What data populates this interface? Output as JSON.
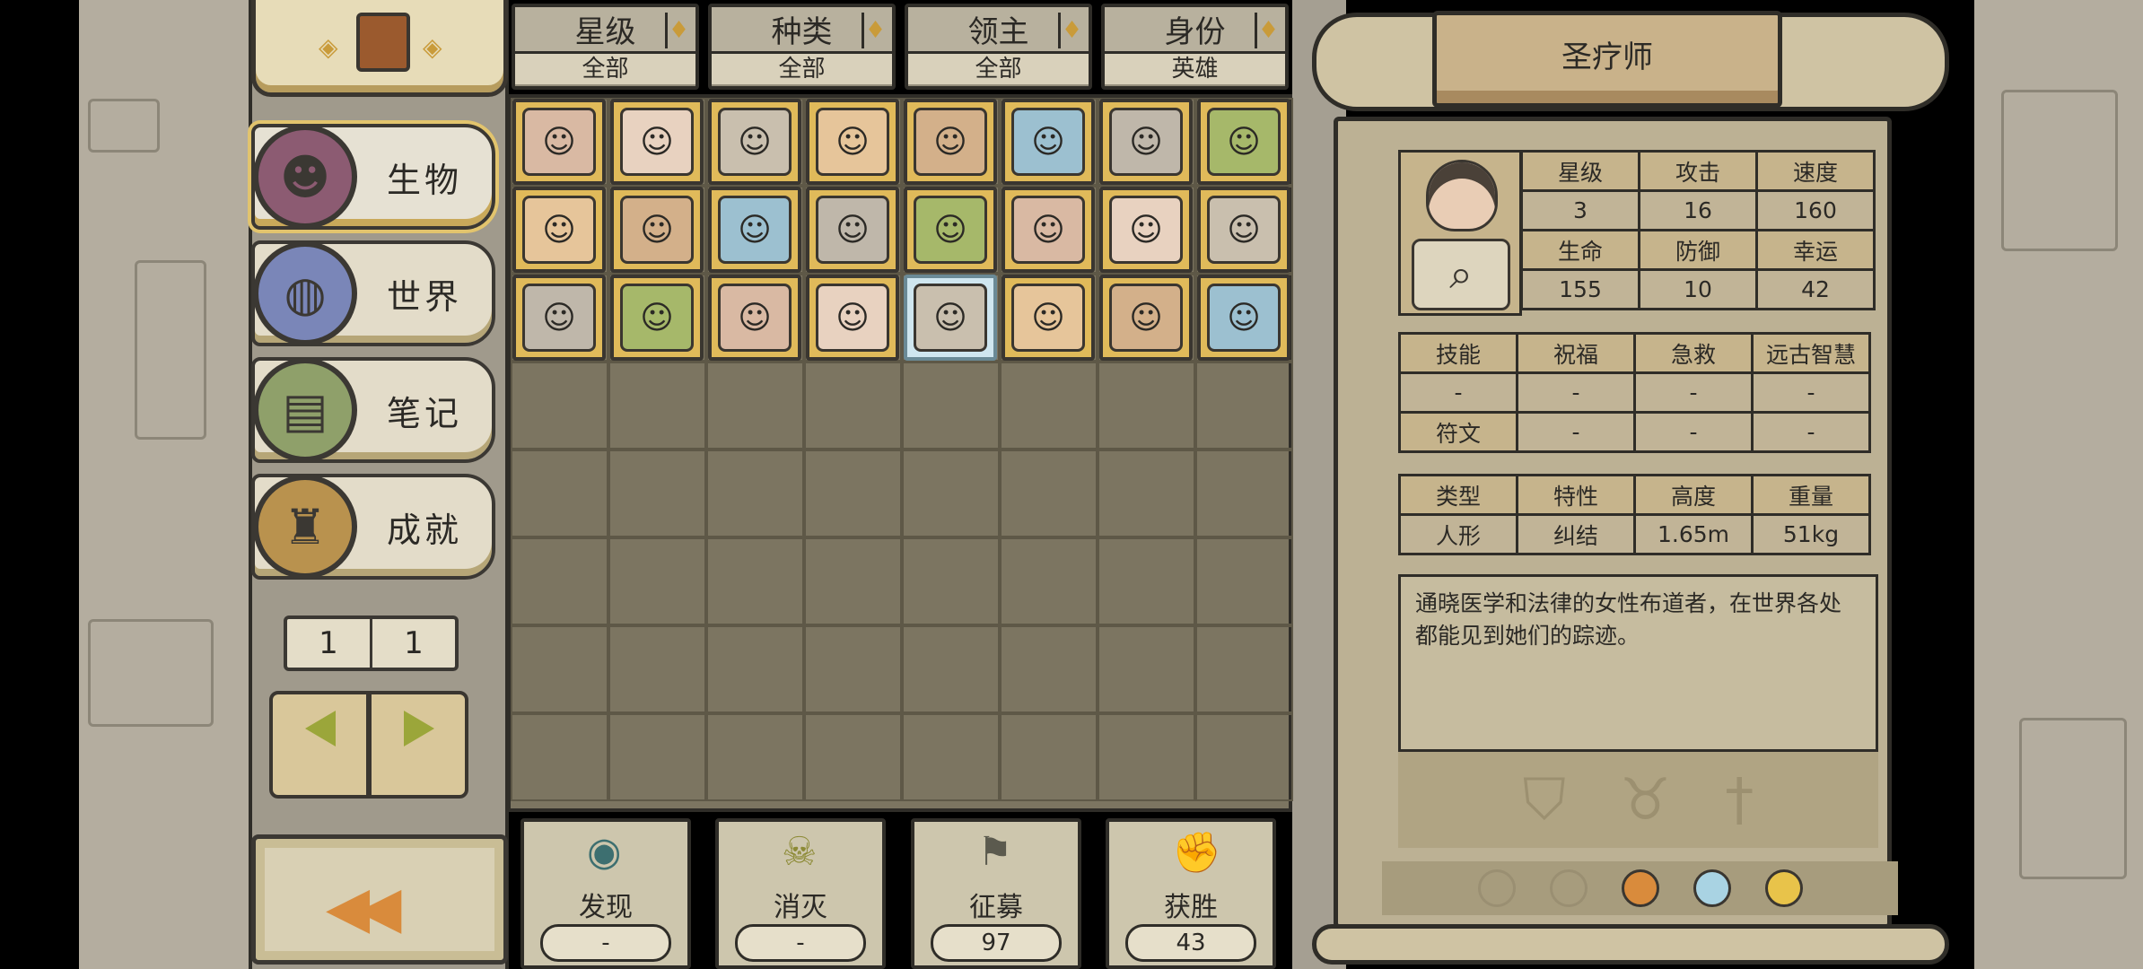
{
  "nav": {
    "items": [
      {
        "label": "生物",
        "icon": "demon-icon",
        "active": true
      },
      {
        "label": "世界",
        "icon": "globe-icon",
        "active": false
      },
      {
        "label": "笔记",
        "icon": "open-book-icon",
        "active": false
      },
      {
        "label": "成就",
        "icon": "trophy-icon",
        "active": false
      }
    ],
    "page_current": "1",
    "page_total": "1"
  },
  "filters": [
    {
      "label": "星级",
      "value": "全部"
    },
    {
      "label": "种类",
      "value": "全部"
    },
    {
      "label": "领主",
      "value": "全部"
    },
    {
      "label": "身份",
      "value": "英雄"
    }
  ],
  "grid": {
    "rows": [
      [
        "knight",
        "saint-healer",
        "helm-warrior",
        "monk",
        "viking",
        "harpy",
        "ogre",
        "goblin-clown"
      ],
      [
        "gold-knight",
        "ninja",
        "barbarian",
        "goblin-mage",
        "flame-knight",
        "elf-sorceress",
        "dryad",
        "orc"
      ],
      [
        "red-demon",
        "amazon",
        "goblin-warrior",
        "naga",
        "old-sage",
        "pig-orc",
        "elf-girl",
        "mummy"
      ]
    ],
    "selected": "old-sage"
  },
  "stats": [
    {
      "label": "发现",
      "value": "-",
      "icon": "eye-icon"
    },
    {
      "label": "消灭",
      "value": "-",
      "icon": "skull-icon"
    },
    {
      "label": "征募",
      "value": "97",
      "icon": "flag-icon"
    },
    {
      "label": "获胜",
      "value": "43",
      "icon": "fist-icon"
    }
  ],
  "detail": {
    "title": "圣疗师",
    "attrs": {
      "star_label": "星级",
      "star": "3",
      "atk_label": "攻击",
      "atk": "16",
      "spd_label": "速度",
      "spd": "160",
      "hp_label": "生命",
      "hp": "155",
      "def_label": "防御",
      "def": "10",
      "luck_label": "幸运",
      "luck": "42"
    },
    "skills": {
      "skill_label": "技能",
      "skill_names": [
        "祝福",
        "急救",
        "远古智慧"
      ],
      "skill_levels": [
        "-",
        "-",
        "-",
        "-"
      ],
      "rune_label": "符文",
      "rune_values": [
        "-",
        "-",
        "-"
      ]
    },
    "traits": {
      "headers": [
        "类型",
        "特性",
        "高度",
        "重量"
      ],
      "values": [
        "人形",
        "纠结",
        "1.65m",
        "51kg"
      ]
    },
    "description": "通晓医学和法律的女性布道者，在世界各处都能见到她们的踪迹。",
    "gear_icons": [
      "shield-icon",
      "horned-helmet-icon",
      "sword-icon"
    ],
    "medal_colors": [
      "#d98b3c",
      "#a9d3e3",
      "#e8c34a"
    ]
  },
  "colors": {
    "card_gold": "#e0ba5a",
    "card_selected": "#cfe6ef",
    "grid_bg": "#7c7561"
  }
}
